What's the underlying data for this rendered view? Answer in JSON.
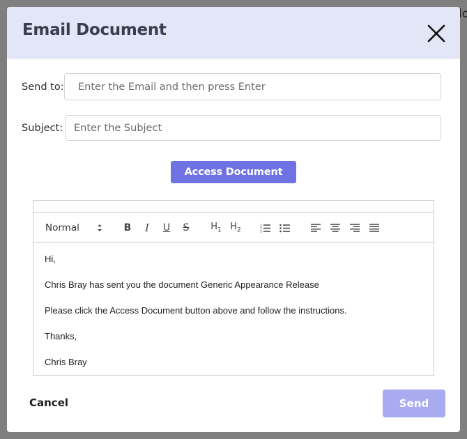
{
  "background": {
    "peek_text": "lo"
  },
  "modal": {
    "title": "Email Document",
    "close_icon": "close-icon",
    "send_to": {
      "label": "Send to:",
      "value": "",
      "placeholder": "Enter the Email and then press Enter"
    },
    "subject": {
      "label": "Subject:",
      "value": "",
      "placeholder": "Enter the Subject"
    },
    "access_button": "Access Document",
    "editor": {
      "toolbar": {
        "format_select": "Normal",
        "bold": "B",
        "italic": "I",
        "underline": "U",
        "strike": "S",
        "h1": "H1",
        "h2": "H2",
        "icons": [
          "ordered-list-icon",
          "bullet-list-icon",
          "align-left-icon",
          "align-center-icon",
          "align-right-icon",
          "align-justify-icon"
        ]
      },
      "body": [
        "Hi,",
        "Chris Bray has sent you the document Generic Appearance Release",
        "Please click the Access Document button above and follow the instructions.",
        "Thanks,",
        "Chris Bray"
      ]
    },
    "cancel_button": "Cancel",
    "send_button": "Send"
  },
  "colors": {
    "header_bg": "#e3e6f6",
    "accent": "#6f72e3",
    "send_disabled": "#a9abf1",
    "overlay": "#7f7f7f"
  }
}
